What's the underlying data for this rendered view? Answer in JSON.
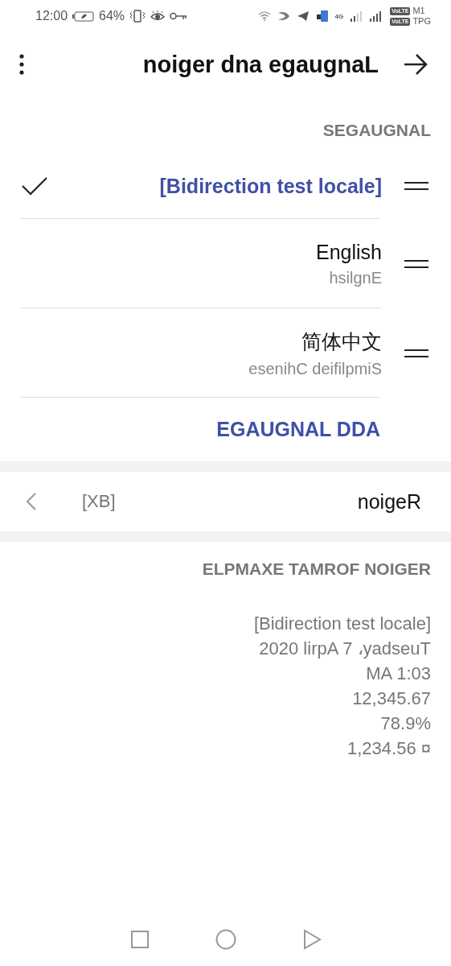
{
  "status_bar": {
    "time": "12:00",
    "battery": "64%",
    "network": "4G",
    "sims": [
      {
        "badge": "VoLTE",
        "carrier": "M1"
      },
      {
        "badge": "VoLTE",
        "carrier": "TPG"
      }
    ]
  },
  "toolbar": {
    "title": "noiger dna egaugnaL"
  },
  "languages": {
    "header": "SEGAUGNAL",
    "items": [
      {
        "name": "[Bidirection test locale]",
        "selected": true
      },
      {
        "name": "English",
        "subtitle": "hsilgnE",
        "selected": false
      },
      {
        "name": "简体中文",
        "subtitle": "esenihC deifilpmiS",
        "selected": false
      }
    ],
    "add_button": "EGAUGNAL DDA"
  },
  "region": {
    "value": "[XB]",
    "label": "noigeR"
  },
  "region_format": {
    "header": "ELPMAXE TAMROF NOIGER",
    "examples": [
      "[Bidirection test locale]",
      "2020 lirpA 7 ،yadseuT",
      "MA 1:03",
      "12,345.67",
      "78.9%",
      "1,234.56 ¤"
    ]
  }
}
